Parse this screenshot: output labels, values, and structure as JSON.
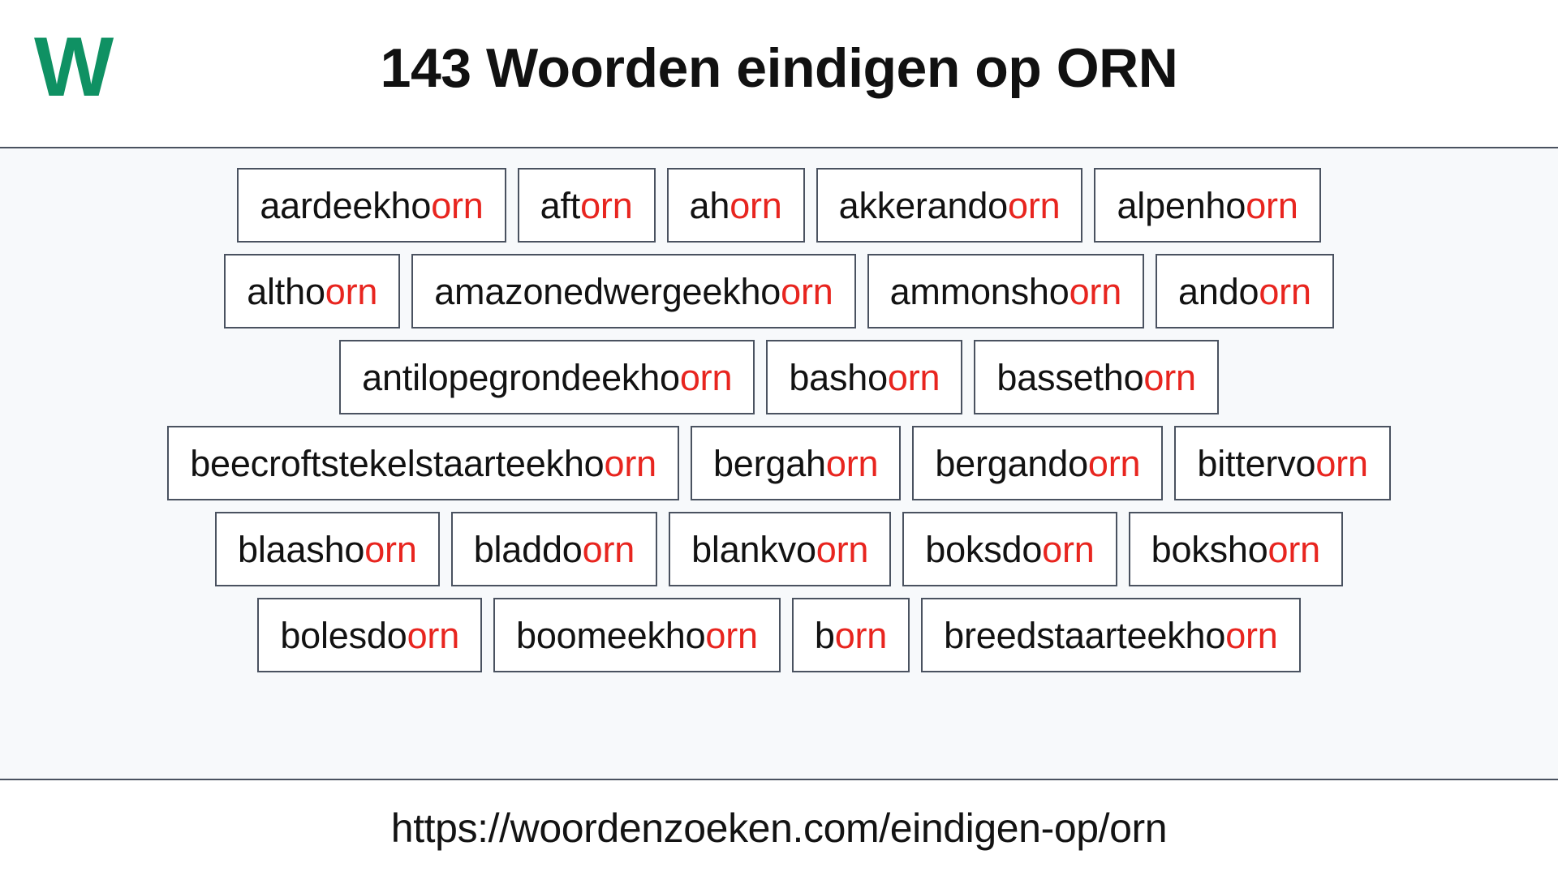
{
  "header": {
    "logo_text": "W",
    "logo_color": "#0f9163",
    "title": "143 Woorden eindigen op ORN"
  },
  "theme": {
    "suffix_color": "#e8251f",
    "box_border_color": "#4a5260",
    "content_background": "#f7f9fb",
    "box_background": "#ffffff",
    "text_color": "#121212"
  },
  "main": {
    "suffix": "orn",
    "rows": [
      {
        "words": [
          {
            "stem": "aardeekho",
            "suffix": "orn"
          },
          {
            "stem": "aft",
            "suffix": "orn"
          },
          {
            "stem": "ah",
            "suffix": "orn"
          },
          {
            "stem": "akkerando",
            "suffix": "orn"
          },
          {
            "stem": "alpenho",
            "suffix": "orn"
          }
        ]
      },
      {
        "words": [
          {
            "stem": "altho",
            "suffix": "orn"
          },
          {
            "stem": "amazonedwergeekho",
            "suffix": "orn"
          },
          {
            "stem": "ammonsho",
            "suffix": "orn"
          },
          {
            "stem": "ando",
            "suffix": "orn"
          }
        ]
      },
      {
        "words": [
          {
            "stem": "antilopegrondeekho",
            "suffix": "orn"
          },
          {
            "stem": "basho",
            "suffix": "orn"
          },
          {
            "stem": "bassetho",
            "suffix": "orn"
          }
        ]
      },
      {
        "words": [
          {
            "stem": "beecroftstekelstaarteekho",
            "suffix": "orn"
          },
          {
            "stem": "bergah",
            "suffix": "orn"
          },
          {
            "stem": "bergando",
            "suffix": "orn"
          },
          {
            "stem": "bittervo",
            "suffix": "orn"
          }
        ]
      },
      {
        "words": [
          {
            "stem": "blaasho",
            "suffix": "orn"
          },
          {
            "stem": "bladdo",
            "suffix": "orn"
          },
          {
            "stem": "blankvo",
            "suffix": "orn"
          },
          {
            "stem": "boksdo",
            "suffix": "orn"
          },
          {
            "stem": "boksho",
            "suffix": "orn"
          }
        ]
      },
      {
        "words": [
          {
            "stem": "bolesdo",
            "suffix": "orn"
          },
          {
            "stem": "boomeekho",
            "suffix": "orn"
          },
          {
            "stem": "b",
            "suffix": "orn"
          },
          {
            "stem": "breedstaarteekho",
            "suffix": "orn"
          }
        ]
      }
    ]
  },
  "footer": {
    "url": "https://woordenzoeken.com/eindigen-op/orn"
  }
}
